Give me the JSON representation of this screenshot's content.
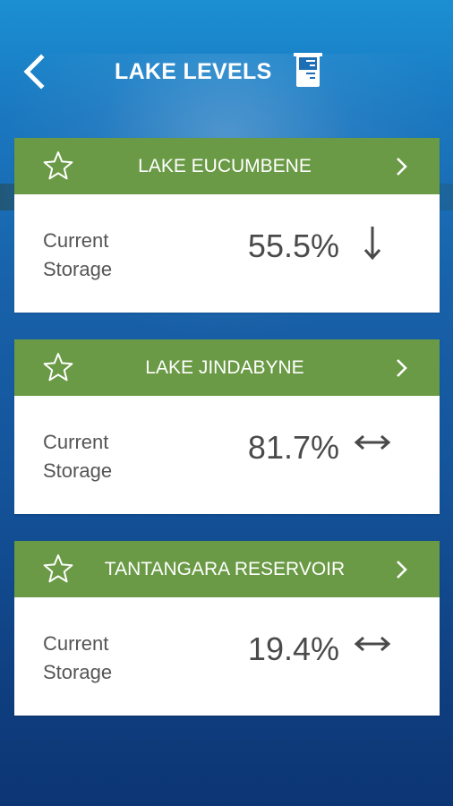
{
  "header": {
    "title": "LAKE LEVELS",
    "back_icon": "chevron-left-icon",
    "action_icon": "beaker-icon"
  },
  "colors": {
    "card_header": "#6a9a45",
    "background_top": "#1b8fd3",
    "background_bottom": "#0c3574",
    "value_text": "#4a4a4a"
  },
  "lakes": [
    {
      "name": "LAKE EUCUMBENE",
      "label_line1": "Current",
      "label_line2": "Storage",
      "storage": "55.5%",
      "trend": "falling",
      "trend_icon": "arrow-down-icon",
      "favorite_icon": "star-outline-icon",
      "open_icon": "chevron-right-icon"
    },
    {
      "name": "LAKE JINDABYNE",
      "label_line1": "Current",
      "label_line2": "Storage",
      "storage": "81.7%",
      "trend": "steady",
      "trend_icon": "arrow-left-right-icon",
      "favorite_icon": "star-outline-icon",
      "open_icon": "chevron-right-icon"
    },
    {
      "name": "TANTANGARA RESERVOIR",
      "label_line1": "Current",
      "label_line2": "Storage",
      "storage": "19.4%",
      "trend": "steady",
      "trend_icon": "arrow-left-right-icon",
      "favorite_icon": "star-outline-icon",
      "open_icon": "chevron-right-icon"
    }
  ]
}
